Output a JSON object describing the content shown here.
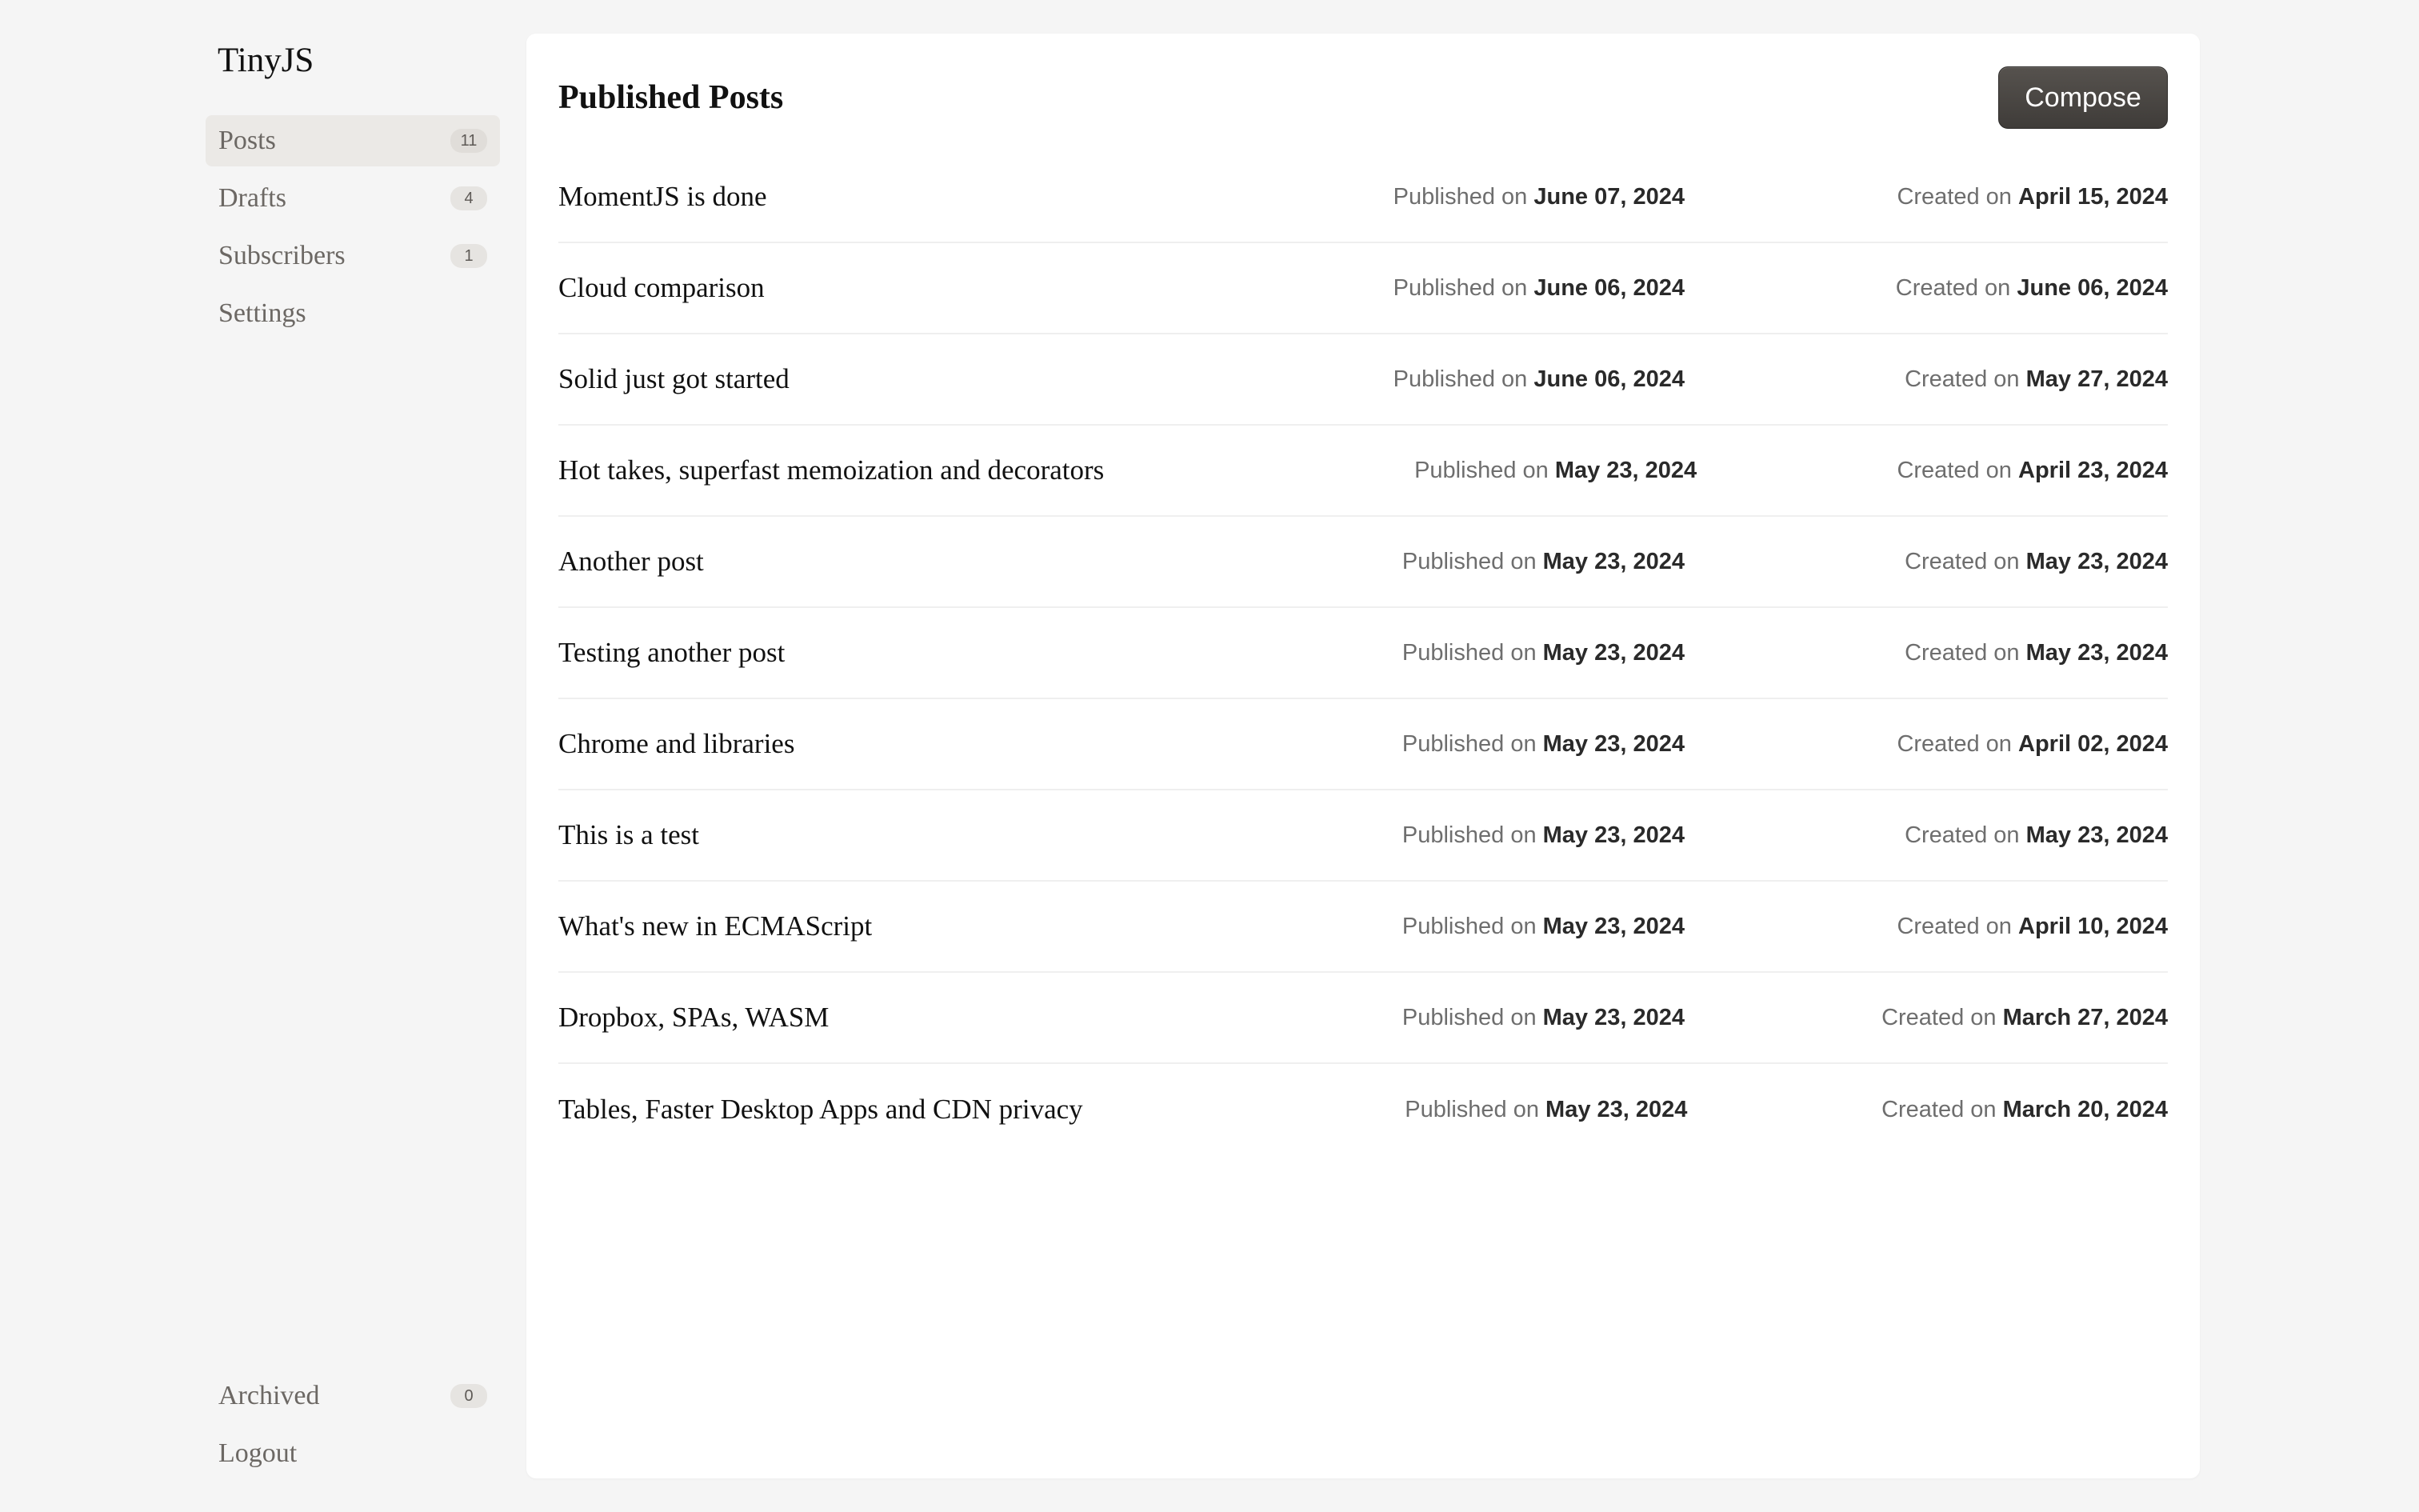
{
  "sidebar": {
    "brand": "TinyJS",
    "items": [
      {
        "label": "Posts",
        "count": "11",
        "active": true
      },
      {
        "label": "Drafts",
        "count": "4"
      },
      {
        "label": "Subscribers",
        "count": "1"
      },
      {
        "label": "Settings"
      }
    ],
    "bottom_items": [
      {
        "label": "Archived",
        "count": "0"
      },
      {
        "label": "Logout"
      }
    ]
  },
  "main": {
    "title": "Published Posts",
    "compose_label": "Compose",
    "published_prefix": "Published on",
    "created_prefix": "Created on",
    "posts": [
      {
        "title": "MomentJS is done",
        "published": "June 07, 2024",
        "created": "April 15, 2024"
      },
      {
        "title": "Cloud comparison",
        "published": "June 06, 2024",
        "created": "June 06, 2024"
      },
      {
        "title": "Solid just got started",
        "published": "June 06, 2024",
        "created": "May 27, 2024"
      },
      {
        "title": "Hot takes, superfast memoization and decorators",
        "published": "May 23, 2024",
        "created": "April 23, 2024"
      },
      {
        "title": "Another post",
        "published": "May 23, 2024",
        "created": "May 23, 2024"
      },
      {
        "title": "Testing another post",
        "published": "May 23, 2024",
        "created": "May 23, 2024"
      },
      {
        "title": "Chrome and libraries",
        "published": "May 23, 2024",
        "created": "April 02, 2024"
      },
      {
        "title": "This is a test",
        "published": "May 23, 2024",
        "created": "May 23, 2024"
      },
      {
        "title": "What's new in ECMAScript",
        "published": "May 23, 2024",
        "created": "April 10, 2024"
      },
      {
        "title": "Dropbox, SPAs, WASM",
        "published": "May 23, 2024",
        "created": "March 27, 2024"
      },
      {
        "title": "Tables, Faster Desktop Apps and CDN privacy",
        "published": "May 23, 2024",
        "created": "March 20, 2024"
      }
    ]
  }
}
